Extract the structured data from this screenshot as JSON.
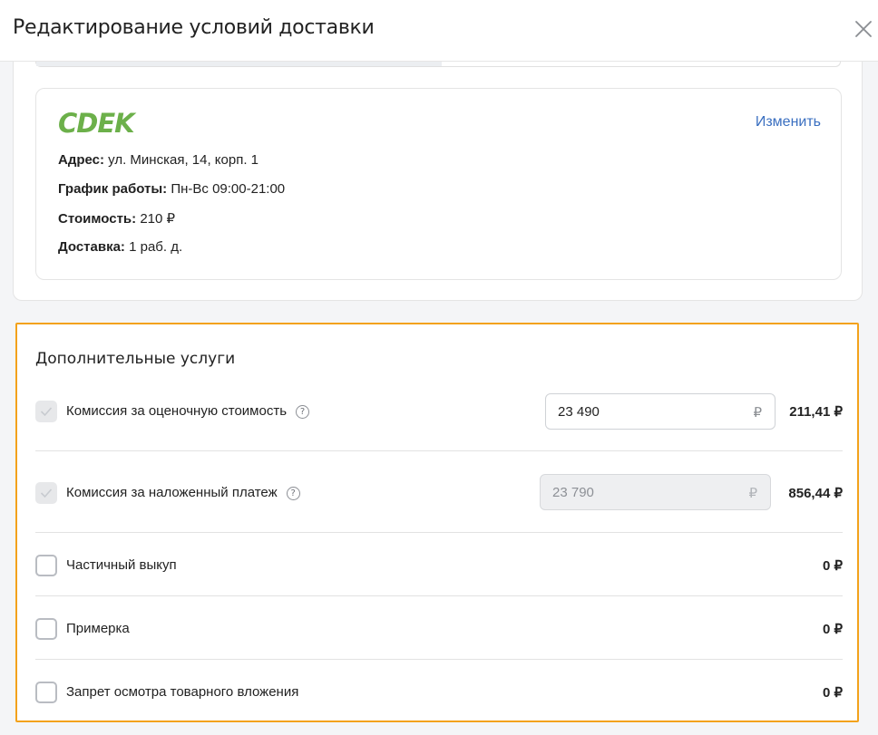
{
  "dialog": {
    "title": "Редактирование условий доставки"
  },
  "pickup_point": {
    "carrier_logo_text": "CDEK",
    "brand_color": "#6cb04a",
    "change_label": "Изменить",
    "address_label": "Адрес:",
    "address_value": "ул. Минская, 14, корп. 1",
    "hours_label": "График работы:",
    "hours_value": "Пн-Вс 09:00-21:00",
    "cost_label": "Стоимость:",
    "cost_value": "210 ₽",
    "delivery_label": "Доставка:",
    "delivery_value": "1 раб. д."
  },
  "services": {
    "title": "Дополнительные услуги",
    "highlight_color": "#f3a21b",
    "items": [
      {
        "label": "Комиссия за оценочную стоимость",
        "help": "?",
        "checked": true,
        "amount": "23 490",
        "currency": "₽",
        "price": "211,41 ₽"
      },
      {
        "label": "Комиссия за наложенный платеж",
        "help": "?",
        "checked": true,
        "amount": "23 790",
        "currency": "₽",
        "price": "856,44 ₽"
      },
      {
        "label": "Частичный выкуп",
        "checked": false,
        "price": "0 ₽"
      },
      {
        "label": "Примерка",
        "checked": false,
        "price": "0 ₽"
      },
      {
        "label": "Запрет осмотра товарного вложения",
        "checked": false,
        "price": "0 ₽"
      }
    ]
  }
}
